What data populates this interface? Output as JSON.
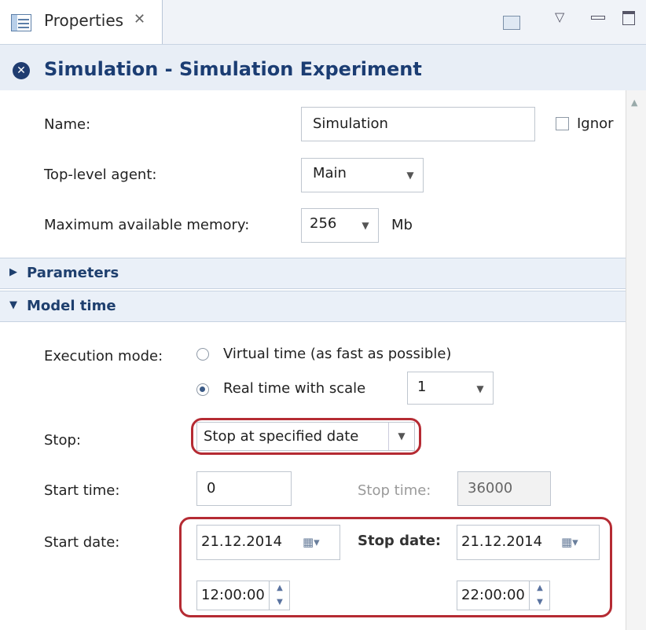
{
  "tab": {
    "label": "Properties",
    "close": "✕"
  },
  "toolbar": {
    "pin_icon": "pin-view-icon",
    "menu_icon": "view-menu-icon",
    "minimize_icon": "minimize-icon",
    "maximize_icon": "maximize-icon"
  },
  "header": {
    "title": "Simulation - Simulation Experiment",
    "icon": "experiment-icon"
  },
  "general": {
    "name_label": "Name:",
    "name_value": "Simulation",
    "ignore_label": "Ignor",
    "agent_label": "Top-level agent:",
    "agent_value": "Main",
    "memory_label": "Maximum available memory:",
    "memory_value": "256",
    "memory_unit": "Mb"
  },
  "sections": {
    "parameters": "Parameters",
    "model_time": "Model time"
  },
  "model_time": {
    "execution_label": "Execution mode:",
    "virtual_label": "Virtual time (as fast as possible)",
    "realtime_label": "Real time with scale",
    "scale_value": "1",
    "stop_label": "Stop:",
    "stop_value": "Stop at specified date",
    "start_time_label": "Start time:",
    "start_time_value": "0",
    "stop_time_label": "Stop time:",
    "stop_time_value": "36000",
    "start_date_label": "Start date:",
    "start_date_value": "21.12.2014",
    "start_clock_value": "12:00:00",
    "stop_date_label": "Stop date:",
    "stop_date_value": "21.12.2014",
    "stop_clock_value": "22:00:00"
  },
  "colors": {
    "highlight": "#b52b33",
    "header_text": "#1b3d73",
    "section_bg": "#eaf0f8"
  }
}
